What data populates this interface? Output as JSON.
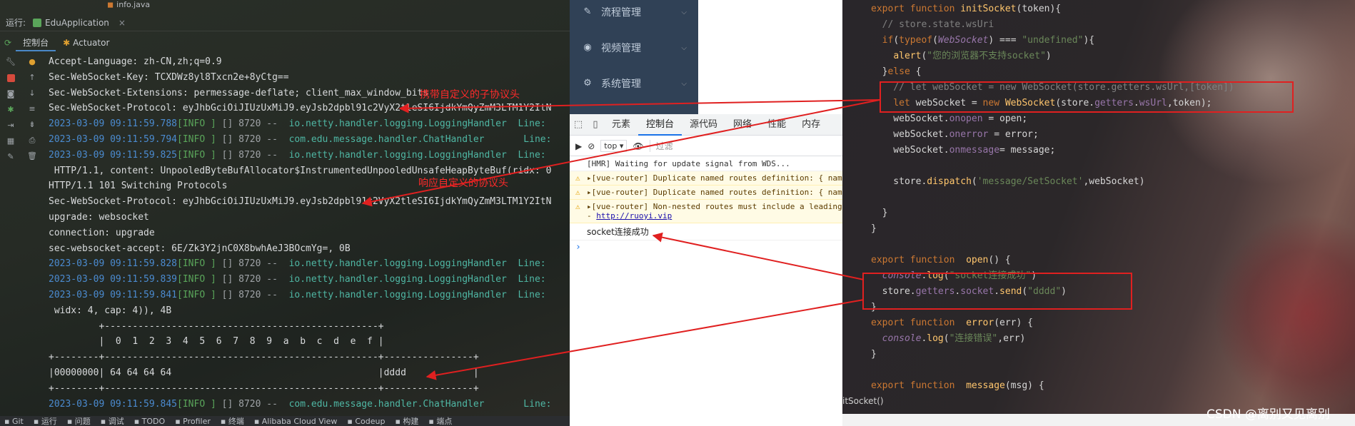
{
  "ide": {
    "file_tab": "info.java",
    "run_label": "运行:",
    "app_name": "EduApplication",
    "tabs": [
      {
        "label": "控制台",
        "icon": "console-icon"
      },
      {
        "label": "Actuator",
        "icon": "actuator-icon"
      }
    ],
    "console_lines": [
      {
        "text": "Accept-Language: zh-CN,zh;q=0.9"
      },
      {
        "text": "Sec-WebSocket-Key: TCXDWz8yl8Txcn2e+8yCtg=="
      },
      {
        "text": "Sec-WebSocket-Extensions: permessage-deflate; client_max_window_bits"
      },
      {
        "text": "Sec-WebSocket-Protocol: eyJhbGciOiJIUzUxMiJ9.eyJsb2dpbl91c2VyX2tleSI6IjdkYmQyZmM3LTM1Y2ItN"
      },
      {
        "ts": "2023-03-09 09:11:59.788",
        "lvl": "[INFO ]",
        "rest": " [] 8720 --  ",
        "cls": "io.netty.handler.logging.LoggingHandler",
        "tail": "  Line:"
      },
      {
        "ts": "2023-03-09 09:11:59.794",
        "lvl": "[INFO ]",
        "rest": " [] 8720 --  ",
        "cls": "com.edu.message.handler.ChatHandler     ",
        "tail": "  Line:"
      },
      {
        "ts": "2023-03-09 09:11:59.825",
        "lvl": "[INFO ]",
        "rest": " [] 8720 --  ",
        "cls": "io.netty.handler.logging.LoggingHandler",
        "tail": "  Line:"
      },
      {
        "text": " HTTP/1.1, content: UnpooledByteBufAllocator$InstrumentedUnpooledUnsafeHeapByteBuf(ridx: 0"
      },
      {
        "text": "HTTP/1.1 101 Switching Protocols"
      },
      {
        "text": "Sec-WebSocket-Protocol: eyJhbGciOiJIUzUxMiJ9.eyJsb2dpbl91c2VyX2tleSI6IjdkYmQyZmM3LTM1Y2ItN"
      },
      {
        "text": "upgrade: websocket"
      },
      {
        "text": "connection: upgrade"
      },
      {
        "text": "sec-websocket-accept: 6E/Zk3Y2jnC0X8bwhAeJ3BOcmYg=, 0B"
      },
      {
        "ts": "2023-03-09 09:11:59.828",
        "lvl": "[INFO ]",
        "rest": " [] 8720 --  ",
        "cls": "io.netty.handler.logging.LoggingHandler",
        "tail": "  Line:"
      },
      {
        "ts": "2023-03-09 09:11:59.839",
        "lvl": "[INFO ]",
        "rest": " [] 8720 --  ",
        "cls": "io.netty.handler.logging.LoggingHandler",
        "tail": "  Line:"
      },
      {
        "ts": "2023-03-09 09:11:59.841",
        "lvl": "[INFO ]",
        "rest": " [] 8720 --  ",
        "cls": "io.netty.handler.logging.LoggingHandler",
        "tail": "  Line:"
      },
      {
        "text": " widx: 4, cap: 4)), 4B"
      },
      {
        "text": "         +-------------------------------------------------+"
      },
      {
        "text": "         |  0  1  2  3  4  5  6  7  8  9  a  b  c  d  e  f |"
      },
      {
        "text": "+--------+-------------------------------------------------+----------------+"
      },
      {
        "text": "|00000000| 64 64 64 64                                     |dddd            |"
      },
      {
        "text": "+--------+-------------------------------------------------+----------------+"
      },
      {
        "ts": "2023-03-09 09:11:59.845",
        "lvl": "[INFO ]",
        "rest": " [] 8720 --  ",
        "cls": "com.edu.message.handler.ChatHandler     ",
        "tail": "  Line:"
      }
    ],
    "annotations": {
      "subprotocol": "携带自定义的子协议头",
      "response": "响应自定义的协议头"
    },
    "bottom_tools": [
      {
        "label": "Git",
        "icon": "git-icon"
      },
      {
        "label": "运行",
        "icon": "run-icon"
      },
      {
        "label": "问题",
        "icon": "problems-icon"
      },
      {
        "label": "调试",
        "icon": "debug-icon"
      },
      {
        "label": "TODO",
        "icon": "todo-icon"
      },
      {
        "label": "Profiler",
        "icon": "profiler-icon"
      },
      {
        "label": "终端",
        "icon": "terminal-icon"
      },
      {
        "label": "Alibaba Cloud View",
        "icon": "cloud-icon"
      },
      {
        "label": "Codeup",
        "icon": "codeup-icon"
      },
      {
        "label": "构建",
        "icon": "build-icon"
      },
      {
        "label": "端点",
        "icon": "endpoints-icon"
      }
    ]
  },
  "sidebar": {
    "items": [
      {
        "label": "流程管理",
        "icon": "edit-icon"
      },
      {
        "label": "视频管理",
        "icon": "globe-icon"
      },
      {
        "label": "系统管理",
        "icon": "gear-icon"
      }
    ]
  },
  "devtools": {
    "tabs": [
      "元素",
      "控制台",
      "源代码",
      "网络",
      "性能",
      "内存"
    ],
    "active_tab": "控制台",
    "context": "top",
    "filter_placeholder": "过滤",
    "messages": [
      {
        "type": "info",
        "text": "[HMR] Waiting for update signal from WDS..."
      },
      {
        "type": "warn",
        "text": "[vue-router] Duplicate named routes definition: { nam"
      },
      {
        "type": "warn",
        "text": "[vue-router] Duplicate named routes definition: { nam"
      },
      {
        "type": "warn",
        "text": "[vue-router] Non-nested routes must include a leading",
        "link": "http://ruoyi.vip",
        "link_prefix": "- "
      },
      {
        "type": "success",
        "text": "socket连接成功"
      }
    ]
  },
  "editor": {
    "status_text": "itSocket()",
    "code_lines": [
      [
        {
          "c": "kw",
          "t": "export function "
        },
        {
          "c": "fn",
          "t": "initSocket"
        },
        {
          "c": "",
          "t": "(token){"
        }
      ],
      [
        {
          "c": "cm",
          "t": "  // store.state.wsUri"
        }
      ],
      [
        {
          "c": "kw",
          "t": "  if"
        },
        {
          "c": "",
          "t": "("
        },
        {
          "c": "kw",
          "t": "typeof"
        },
        {
          "c": "",
          "t": "("
        },
        {
          "c": "ital",
          "t": "WebSocket"
        },
        {
          "c": "",
          "t": ") === "
        },
        {
          "c": "str",
          "t": "\"undefined\""
        },
        {
          "c": "",
          "t": "){"
        }
      ],
      [
        {
          "c": "",
          "t": "    "
        },
        {
          "c": "fn",
          "t": "alert"
        },
        {
          "c": "",
          "t": "("
        },
        {
          "c": "str",
          "t": "\"您的浏览器不支持socket\""
        },
        {
          "c": "",
          "t": ")"
        }
      ],
      [
        {
          "c": "",
          "t": "  }"
        },
        {
          "c": "kw",
          "t": "else "
        },
        {
          "c": "",
          "t": "{"
        }
      ],
      [
        {
          "c": "cm",
          "t": "    // let webSocket = new WebSocket(store.getters.wsUrl,[token])"
        }
      ],
      [
        {
          "c": "kw",
          "t": "    let "
        },
        {
          "c": "",
          "t": "webSocket = "
        },
        {
          "c": "kw",
          "t": "new "
        },
        {
          "c": "fn",
          "t": "WebSocket"
        },
        {
          "c": "",
          "t": "(store."
        },
        {
          "c": "prop",
          "t": "getters"
        },
        {
          "c": "",
          "t": "."
        },
        {
          "c": "prop",
          "t": "wsUrl"
        },
        {
          "c": "",
          "t": ",token);"
        }
      ],
      [
        {
          "c": "",
          "t": "    webSocket."
        },
        {
          "c": "prop",
          "t": "onopen"
        },
        {
          "c": "",
          "t": " = open;"
        }
      ],
      [
        {
          "c": "",
          "t": "    webSocket."
        },
        {
          "c": "prop",
          "t": "onerror"
        },
        {
          "c": "",
          "t": " = error;"
        }
      ],
      [
        {
          "c": "",
          "t": "    webSocket."
        },
        {
          "c": "prop",
          "t": "onmessage"
        },
        {
          "c": "",
          "t": "= message;"
        }
      ],
      [
        {
          "c": "",
          "t": ""
        }
      ],
      [
        {
          "c": "",
          "t": "    store."
        },
        {
          "c": "fn",
          "t": "dispatch"
        },
        {
          "c": "",
          "t": "("
        },
        {
          "c": "str",
          "t": "'message/SetSocket'"
        },
        {
          "c": "",
          "t": ",webSocket)"
        }
      ],
      [
        {
          "c": "",
          "t": ""
        }
      ],
      [
        {
          "c": "",
          "t": "  }"
        }
      ],
      [
        {
          "c": "",
          "t": "}"
        }
      ],
      [
        {
          "c": "",
          "t": ""
        }
      ],
      [
        {
          "c": "kw",
          "t": "export function  "
        },
        {
          "c": "fn",
          "t": "open"
        },
        {
          "c": "",
          "t": "() {"
        }
      ],
      [
        {
          "c": "",
          "t": "  "
        },
        {
          "c": "ital",
          "t": "console"
        },
        {
          "c": "",
          "t": "."
        },
        {
          "c": "fn",
          "t": "log"
        },
        {
          "c": "",
          "t": "("
        },
        {
          "c": "str",
          "t": "\"socket连接成功\""
        },
        {
          "c": "",
          "t": ")"
        }
      ],
      [
        {
          "c": "",
          "t": "  store."
        },
        {
          "c": "prop",
          "t": "getters"
        },
        {
          "c": "",
          "t": "."
        },
        {
          "c": "prop",
          "t": "socket"
        },
        {
          "c": "",
          "t": "."
        },
        {
          "c": "fn",
          "t": "send"
        },
        {
          "c": "",
          "t": "("
        },
        {
          "c": "str",
          "t": "\"dddd\""
        },
        {
          "c": "",
          "t": ")"
        }
      ],
      [
        {
          "c": "",
          "t": "}"
        }
      ],
      [
        {
          "c": "kw",
          "t": "export function  "
        },
        {
          "c": "fn",
          "t": "error"
        },
        {
          "c": "",
          "t": "(err) {"
        }
      ],
      [
        {
          "c": "",
          "t": "  "
        },
        {
          "c": "ital",
          "t": "console"
        },
        {
          "c": "",
          "t": "."
        },
        {
          "c": "fn",
          "t": "log"
        },
        {
          "c": "",
          "t": "("
        },
        {
          "c": "str",
          "t": "\"连接错误\""
        },
        {
          "c": "",
          "t": ",err)"
        }
      ],
      [
        {
          "c": "",
          "t": "}"
        }
      ],
      [
        {
          "c": "",
          "t": ""
        }
      ],
      [
        {
          "c": "kw",
          "t": "export function  "
        },
        {
          "c": "fn",
          "t": "message"
        },
        {
          "c": "",
          "t": "(msg) {"
        }
      ]
    ]
  },
  "watermark": "CSDN @离别又见离别",
  "colors": {
    "annotation_red": "#ff2a2a",
    "log_timestamp": "#4b8bd0",
    "log_level": "#5aa55a",
    "log_class": "#4fb7a4",
    "sidebar_bg": "#304156",
    "devtools_active": "#1a73e8"
  }
}
